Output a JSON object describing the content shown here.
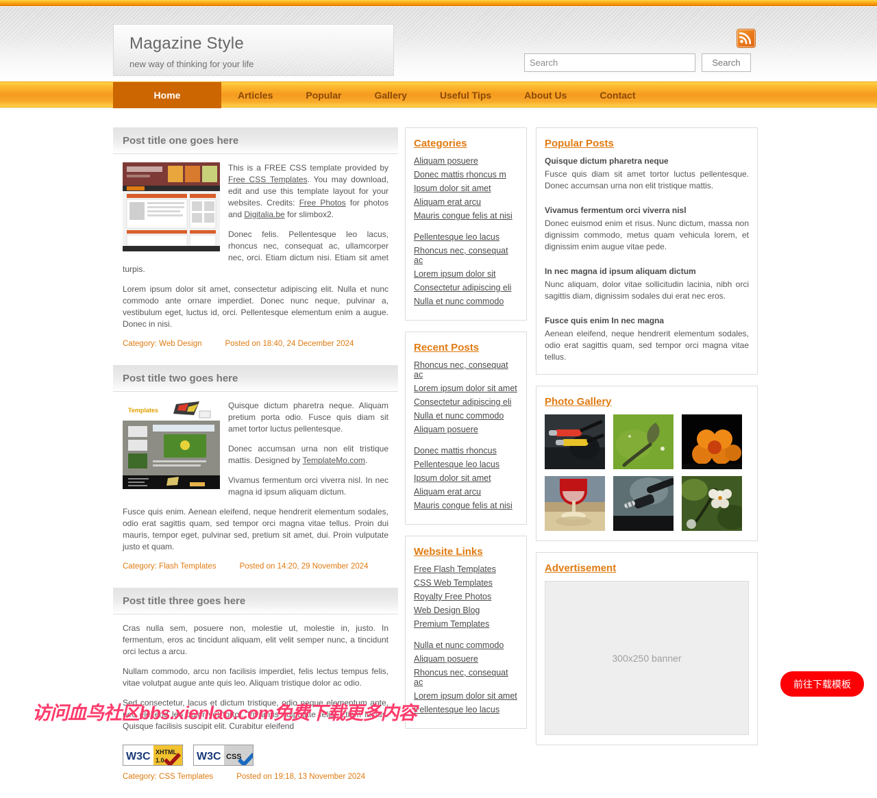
{
  "site": {
    "title": "Magazine Style",
    "tagline": "new way of thinking for your life"
  },
  "header": {
    "rss_icon": "rss-icon",
    "search": {
      "placeholder": "Search",
      "value": "",
      "button_label": "Search"
    }
  },
  "nav": {
    "items": [
      {
        "label": "Home",
        "active": true
      },
      {
        "label": "Articles",
        "active": false
      },
      {
        "label": "Popular",
        "active": false
      },
      {
        "label": "Gallery",
        "active": false
      },
      {
        "label": "Useful Tips",
        "active": false
      },
      {
        "label": "About Us",
        "active": false
      },
      {
        "label": "Contact",
        "active": false
      }
    ]
  },
  "posts": [
    {
      "title": "Post title one goes here",
      "p1_a": "This is a FREE CSS template provided by ",
      "p1_link1": "Free CSS Templates",
      "p1_b": ". You may download, edit and use this template layout for your websites. Credits: ",
      "p1_link2": "Free Photos",
      "p1_c": " for photos and ",
      "p1_link3": "Digitalia.be",
      "p1_d": " for slimbox2.",
      "p2": "Donec felis. Pellentesque leo lacus, rhoncus nec, consequat ac, ullamcorper nec, orci. Etiam dictum nisi. Etiam sit amet turpis.",
      "p3": "Lorem ipsum dolor sit amet, consectetur adipiscing elit. Nulla et nunc commodo ante ornare imperdiet. Donec nunc neque, pulvinar a, vestibulum eget, luctus id, orci. Pellentesque elementum enim a augue. Donec in nisi.",
      "category": "Category: Web Design",
      "posted": "Posted on 18:40, 24 December 2024"
    },
    {
      "title": "Post title two goes here",
      "p1": "Quisque dictum pharetra neque. Aliquam pretium porta odio. Fusce quis diam sit amet tortor luctus pellentesque.",
      "p2_a": "Donec accumsan urna non elit tristique mattis. Designed by ",
      "p2_link": "TemplateMo.com",
      "p2_b": ".",
      "p3": "Vivamus fermentum orci viverra nisl. In nec magna id ipsum aliquam dictum.",
      "p4": "Fusce quis enim. Aenean eleifend, neque hendrerit elementum sodales, odio erat sagittis quam, sed tempor orci magna vitae tellus. Proin dui mauris, tempor eget, pulvinar sed, pretium sit amet, dui. Proin vulputate justo et quam.",
      "category": "Category: Flash Templates",
      "posted": "Posted on 14:20, 29 November 2024"
    },
    {
      "title": "Post title three goes here",
      "p1": "Cras nulla sem, posuere non, molestie ut, molestie in, justo. In fermentum, eros ac tincidunt aliquam, elit velit semper nunc, a tincidunt orci lectus a arcu.",
      "p2": "Nullam commodo, arcu non facilisis imperdiet, felis lectus tempus felis, vitae volutpat augue ante quis leo. Aliquam tristique dolor ac odio.",
      "p3": "Sed consectetur, lacus et dictum tristique, odio neque elementum ante, nec eleifend leo dolor vel tortor. Vivamus vulputate felis. Etiam luctus. Quisque facilisis suscipit elit. Curabitur eleifend",
      "badges": [
        {
          "org": "W3C",
          "label": "XHTML 1.0"
        },
        {
          "org": "W3C",
          "label": "CSS"
        }
      ],
      "category": "Category: CSS Templates",
      "posted": "Posted on 19:18, 13 November 2024"
    }
  ],
  "sidebar": {
    "categories": {
      "title": "Categories",
      "group1": [
        "Aliquam posuere",
        "Donec mattis rhoncus m",
        "Ipsum dolor sit amet",
        "Aliquam erat arcu",
        "Mauris congue felis at nisi"
      ],
      "group2": [
        "Pellentesque leo lacus",
        "Rhoncus nec, consequat ac",
        "Lorem ipsum dolor sit",
        "Consectetur adipiscing eli",
        "Nulla et nunc commodo"
      ]
    },
    "recent_posts": {
      "title": "Recent Posts",
      "group1": [
        "Rhoncus nec, consequat ac",
        "Lorem ipsum dolor sit amet",
        "Consectetur adipiscing eli",
        "Nulla et nunc commodo",
        "Aliquam posuere"
      ],
      "group2": [
        "Donec mattis rhoncus",
        "Pellentesque leo lacus",
        "Ipsum dolor sit amet",
        "Aliquam erat arcu",
        "Mauris congue felis at nisi"
      ]
    },
    "website_links": {
      "title": "Website Links",
      "group1": [
        "Free Flash Templates",
        "CSS Web Templates",
        "Royalty Free Photos",
        "Web Design Blog",
        "Premium Templates"
      ],
      "group2": [
        "Nulla et nunc commodo",
        "Aliquam posuere",
        "Rhoncus nec, consequat ac",
        "Lorem ipsum dolor sit amet",
        "Pellentesque leo lacus"
      ]
    }
  },
  "popular_posts": {
    "title": "Popular Posts",
    "items": [
      {
        "title": "Quisque dictum pharetra neque",
        "text": "Fusce quis diam sit amet tortor luctus pellentesque. Donec accumsan urna non elit tristique mattis."
      },
      {
        "title": "Vivamus fermentum orci viverra nisl",
        "text": "Donec euismod enim et risus. Nunc dictum, massa non dignissim commodo, metus quam vehicula lorem, et dignissim enim augue vitae pede."
      },
      {
        "title": "In nec magna id ipsum aliquam dictum",
        "text": "Nunc aliquam, dolor vitae sollicitudin lacinia, nibh orci sagittis diam, dignissim sodales dui erat nec eros."
      },
      {
        "title": "Fusce quis enim In nec magna",
        "text": "Aenean eleifend, neque hendrerit elementum sodales, odio erat sagittis quam, sed tempor orci magna vitae tellus."
      }
    ]
  },
  "photo_gallery": {
    "title": "Photo Gallery",
    "thumbs": [
      "rca-connectors-photo",
      "green-flower-bud-photo",
      "oranges-on-black-photo",
      "red-wine-glass-photo",
      "audio-jack-photo",
      "white-orchid-photo"
    ]
  },
  "advertisement": {
    "title": "Advertisement",
    "slot_label": "300x250 banner"
  },
  "overlay": {
    "watermark": "访问血鸟社区bbs.xienlao.com免费下载更多内容",
    "cta_label": "前往下载模板"
  },
  "colors": {
    "accent_orange": "#e07b12",
    "nav_active": "#cc6600",
    "cta_red": "#fc0006",
    "watermark_pink": "#ff3b6b"
  }
}
